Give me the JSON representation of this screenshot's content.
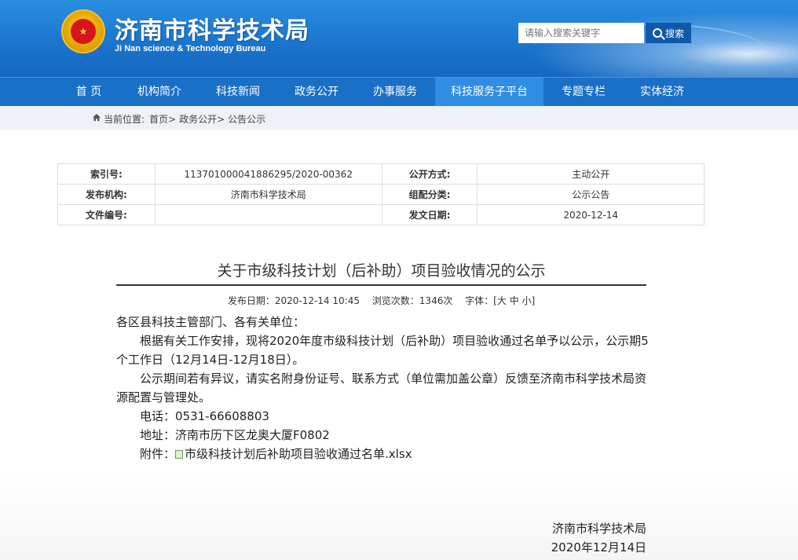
{
  "header": {
    "title": "济南市科学技术局",
    "subtitle": "Ji Nan science & Technology Bureau",
    "emblem_glyph": "★",
    "search": {
      "placeholder": "请输入搜索关键字",
      "button_label": "搜索"
    }
  },
  "nav": {
    "items": [
      {
        "label": "首 页"
      },
      {
        "label": "机构简介"
      },
      {
        "label": "科技新闻"
      },
      {
        "label": "政务公开"
      },
      {
        "label": "办事服务"
      },
      {
        "label": "科技服务子平台"
      },
      {
        "label": "专题专栏"
      },
      {
        "label": "实体经济"
      }
    ],
    "active_index": 5
  },
  "breadcrumb": {
    "prefix": "当前位置:",
    "items": [
      "首页>",
      "政务公开>",
      "公告公示"
    ]
  },
  "info": {
    "rows": [
      {
        "label1": "索引号:",
        "value1": "11370100004188629​5/2020-00362",
        "label2": "公开方式:",
        "value2": "主动公开"
      },
      {
        "label1": "发布机构:",
        "value1": "济南市科学技术局",
        "label2": "组配分类:",
        "value2": "公示公告"
      },
      {
        "label1": "文件编号:",
        "value1": "",
        "label2": "发文日期:",
        "value2": "2020-12-14"
      }
    ]
  },
  "article": {
    "title": "关于市级科技计划（后补助）项目验收情况的公示",
    "meta": {
      "date": "发布日期：2020-12-14 10:45",
      "views": "浏览次数：1346次",
      "font_label": "字体：[大 中 小]"
    },
    "salutation": "各区县科技主管部门、各有关单位：",
    "para1": "根据有关工作安排，现将2020年度市级科技计划（后补助）项目验收通过名单予以公示，公示期5个工作日（12月14日-12月18日）。",
    "para2": "公示期间若有异议，请实名附身份证号、联系方式（单位需加盖公章）反馈至济南市科学技术局资源配置与管理处。",
    "phone": "电话：0531-66608803",
    "address": "地址：济南市历下区龙奥大厦F0802",
    "attachment_label": "附件：",
    "attachment_file": "市级科技计划后补助项目验收通过名单.xlsx",
    "signature_org": "济南市科学技术局",
    "signature_date": "2020年12月14日"
  },
  "colors": {
    "header_blue": "#1a73cc",
    "nav_blue": "#1a6fc7",
    "nav_active": "#2f8de4",
    "search_button": "#0f5aa8"
  }
}
